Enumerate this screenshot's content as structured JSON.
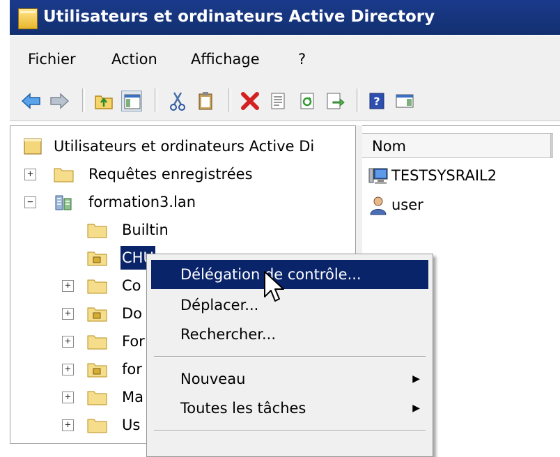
{
  "window": {
    "title": "Utilisateurs et ordinateurs Active Directory"
  },
  "menubar": {
    "items": [
      "Fichier",
      "Action",
      "Affichage",
      "?"
    ]
  },
  "toolbar": {
    "buttons": [
      "back-icon",
      "forward-icon",
      "up-folder-icon",
      "show-hide-console-tree-icon",
      "cut-icon",
      "paste-icon",
      "delete-icon",
      "properties-icon",
      "refresh-icon",
      "export-list-icon",
      "help-icon",
      "show-action-pane-icon"
    ]
  },
  "tree": {
    "root": "Utilisateurs et ordinateurs Active Di",
    "saved_queries": "Requêtes enregistrées",
    "domain": "formation3.lan",
    "children": [
      "Builtin",
      "CHU",
      "Co",
      "Do",
      "For",
      "for",
      "Ma",
      "Us"
    ]
  },
  "list": {
    "column_name": "Nom",
    "items": [
      {
        "name": "TESTSYSRAIL2",
        "icon": "computer-icon"
      },
      {
        "name": "user",
        "icon": "user-icon"
      }
    ]
  },
  "context_menu": {
    "items": [
      "Délégation de contrôle...",
      "Déplacer...",
      "Rechercher...",
      "Nouveau",
      "Toutes les tâches"
    ],
    "highlighted": "Délégation de contrôle...",
    "submenu_arrow": "▶"
  },
  "colors": {
    "title_bar": "#12306f",
    "selection": "#0a246a",
    "menu_bg": "#f0f0f0"
  }
}
